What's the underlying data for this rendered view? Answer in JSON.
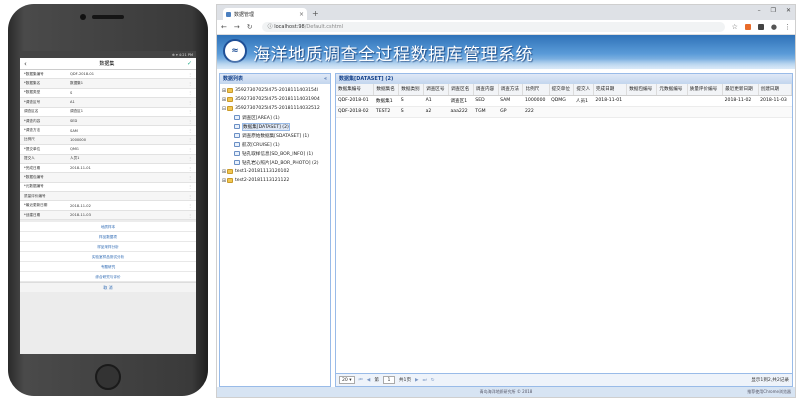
{
  "mobile": {
    "status_right": "⊕ ▾ 4:21 PM",
    "title": "数据集",
    "fields": [
      {
        "label": "*数据集编号",
        "value": "QDF-2018-01"
      },
      {
        "label": "*数据集名",
        "value": "数据集1"
      },
      {
        "label": "*数据类型",
        "value": "S"
      },
      {
        "label": "*调查区号",
        "value": "A1"
      },
      {
        "label": "调查区名",
        "value": "调查区1"
      },
      {
        "label": "*调查内容",
        "value": "SED"
      },
      {
        "label": "*调查方法",
        "value": "SAM"
      },
      {
        "label": "比例尺",
        "value": "1000000"
      },
      {
        "label": "*提交单位",
        "value": "QMG"
      },
      {
        "label": "提交人",
        "value": "人员1"
      },
      {
        "label": "*完成日期",
        "value": "2018-11-01"
      },
      {
        "label": "*数据包编号",
        "value": ""
      },
      {
        "label": "*元数据编号",
        "value": ""
      },
      {
        "label": "质量评价编号",
        "value": ""
      },
      {
        "label": "*最近更新日期",
        "value": "2018-11-02"
      },
      {
        "label": "*创建日期",
        "value": "2018-11-03"
      }
    ],
    "links": [
      "地质样本",
      "样品数据项",
      "样品采样分析",
      "实验室样品测试分析",
      "专题研究",
      "综合研究与评价"
    ],
    "footer": "取 消"
  },
  "browser": {
    "tab_title": "数据管理",
    "url_host": "localhost:98",
    "url_path": "/Default.cshtml",
    "info_icon": "ⓘ"
  },
  "app": {
    "title": "海洋地质调查全过程数据库管理系统",
    "logo_text": "≈",
    "tree_panel_title": "数据列表",
    "tree": [
      {
        "label": "35927307025l475-2018111403154l",
        "level": 0,
        "type": "folder",
        "exp": "⊞"
      },
      {
        "label": "35927307025l475-20181114031904",
        "level": 0,
        "type": "folder",
        "exp": "⊞"
      },
      {
        "label": "35927307025l475-20181114032512",
        "level": 0,
        "type": "folder",
        "exp": "⊟"
      },
      {
        "label": "调查区[AREA] (1)",
        "level": 1,
        "type": "doc",
        "exp": ""
      },
      {
        "label": "数据集[DATASET] (2)",
        "level": 1,
        "type": "doc",
        "exp": "",
        "selected": true
      },
      {
        "label": "调查原始数据集[SDATASET] (1)",
        "level": 1,
        "type": "doc",
        "exp": ""
      },
      {
        "label": "航次[CRUISE] (1)",
        "level": 1,
        "type": "doc",
        "exp": ""
      },
      {
        "label": "钻孔取样信息[SD_BOR_INFO] (1)",
        "level": 1,
        "type": "doc",
        "exp": ""
      },
      {
        "label": "钻孔岩心照片[AD_BOR_PHOTO] (2)",
        "level": 1,
        "type": "doc",
        "exp": ""
      },
      {
        "label": "test1-20181113120102",
        "level": 0,
        "type": "folder",
        "exp": "⊞"
      },
      {
        "label": "test2-20181113121122",
        "level": 0,
        "type": "folder",
        "exp": "⊞"
      }
    ],
    "grid_title": "数据集[DATASET] (2)",
    "columns": [
      "数据集编号",
      "数据集名",
      "数据类别",
      "调查区号",
      "调查区名",
      "调查内容",
      "调查方法",
      "比例尺",
      "提交单位",
      "提交人",
      "完成日期",
      "数据包编号",
      "元数据编号",
      "质量评价编号",
      "最近更新日期",
      "创建日期"
    ],
    "rows": [
      [
        "QDF-2018-01",
        "数据集1",
        "S",
        "A1",
        "调查区1",
        "SED",
        "SAM",
        "1000000",
        "QDMG",
        "人员1",
        "2018-11-01",
        "",
        "",
        "",
        "2018-11-02",
        "2018-11-03"
      ],
      [
        "QDF-2018-02",
        "TEST2",
        "S",
        "a2",
        "aaa222",
        "TGM",
        "GP",
        "222",
        "",
        "",
        "",
        "",
        "",
        "",
        "",
        ""
      ]
    ],
    "pager": {
      "page_size": "20 ▾",
      "page_label_pre": "第",
      "page_value": "1",
      "page_label_post": "共1页",
      "info": "显示1到2,共2记录"
    },
    "footer": "青岛海洋地质研究所 © 2018",
    "footer_right": "推荐使用Chrome浏览器"
  }
}
